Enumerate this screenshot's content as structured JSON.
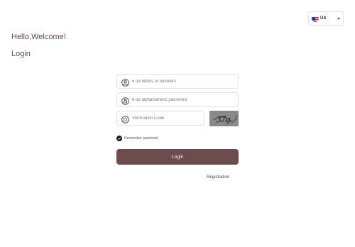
{
  "header": {
    "language": {
      "code": "US",
      "flag_icon": "us-flag-icon"
    }
  },
  "greeting": "Hello,Welcome!",
  "page_title": "Login",
  "form": {
    "username_placeholder": "6-16 letters or numbers",
    "password_placeholder": "6-16 alphanumeric password",
    "captcha_placeholder": "Verification Code",
    "captcha_text": "37g",
    "remember_label": "Remember password",
    "remember_checked": true,
    "login_label": "Login",
    "register_label": "Registration"
  },
  "colors": {
    "accent": "#6d4c4e",
    "title_text": "#6b4a4a"
  }
}
